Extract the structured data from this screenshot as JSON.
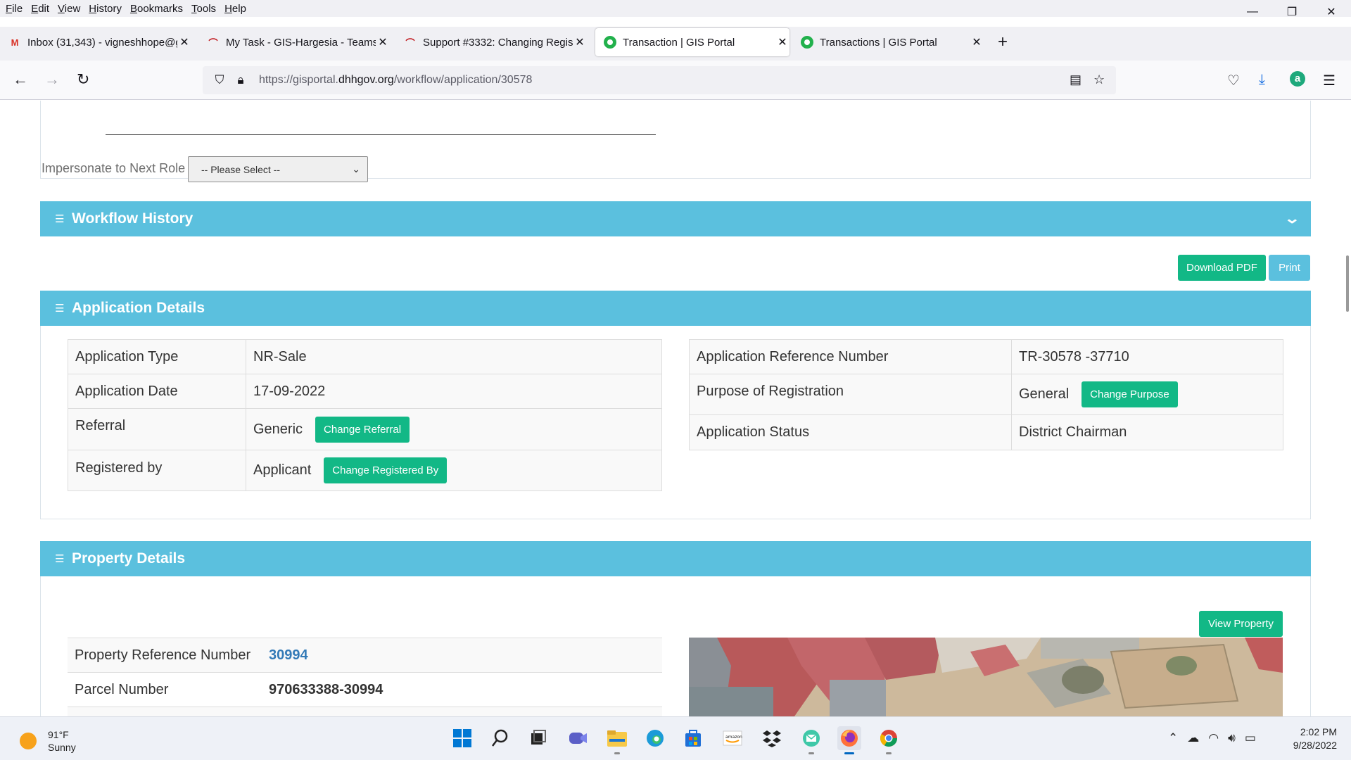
{
  "browser": {
    "menu": [
      "File",
      "Edit",
      "View",
      "History",
      "Bookmarks",
      "Tools",
      "Help"
    ],
    "window_controls": {
      "minimize": "—",
      "restore": "❐",
      "close": "✕"
    },
    "tabs": [
      {
        "title": "Inbox (31,343) - vigneshhope@g",
        "icon": "gmail-icon"
      },
      {
        "title": "My Task - GIS-Hargesia - Teams",
        "icon": "redmine-icon"
      },
      {
        "title": "Support #3332: Changing Regis",
        "icon": "redmine-icon"
      },
      {
        "title": "Transaction | GIS Portal",
        "icon": "gis-portal-icon",
        "active": true
      },
      {
        "title": "Transactions | GIS Portal",
        "icon": "gis-portal-icon"
      }
    ],
    "url_prefix": "https://gisportal.",
    "url_domain": "dhhgov.org",
    "url_path": "/workflow/application/30578"
  },
  "form": {
    "impersonate_label": "Impersonate to Next Role",
    "impersonate_select": "-- Please Select --"
  },
  "sections": {
    "workflow_history": "Workflow History",
    "application_details": "Application Details",
    "property_details": "Property Details"
  },
  "actions": {
    "download_pdf": "Download PDF",
    "print": "Print",
    "view_property": "View Property"
  },
  "application": {
    "left": [
      {
        "label": "Application Type",
        "value": "NR-Sale"
      },
      {
        "label": "Application Date",
        "value": "17-09-2022"
      },
      {
        "label": "Referral",
        "value": "Generic",
        "button": "Change Referral"
      },
      {
        "label": "Registered by",
        "value": "Applicant",
        "button": "Change Registered By"
      }
    ],
    "right": [
      {
        "label": "Application Reference Number",
        "value": "TR-30578 -37710"
      },
      {
        "label": "Purpose of Registration",
        "value": "General",
        "button": "Change Purpose"
      },
      {
        "label": "Application Status",
        "value": "District Chairman"
      }
    ]
  },
  "property": [
    {
      "label": "Property Reference Number",
      "value": "30994"
    },
    {
      "label": "Parcel Number",
      "value": "970633388-30994"
    }
  ],
  "taskbar": {
    "weather_temp": "91°F",
    "weather_desc": "Sunny",
    "time": "2:02 PM",
    "date": "9/28/2022"
  },
  "colors": {
    "section_header": "#5bc0de",
    "primary_button": "#12b886",
    "link": "#337ab7"
  }
}
